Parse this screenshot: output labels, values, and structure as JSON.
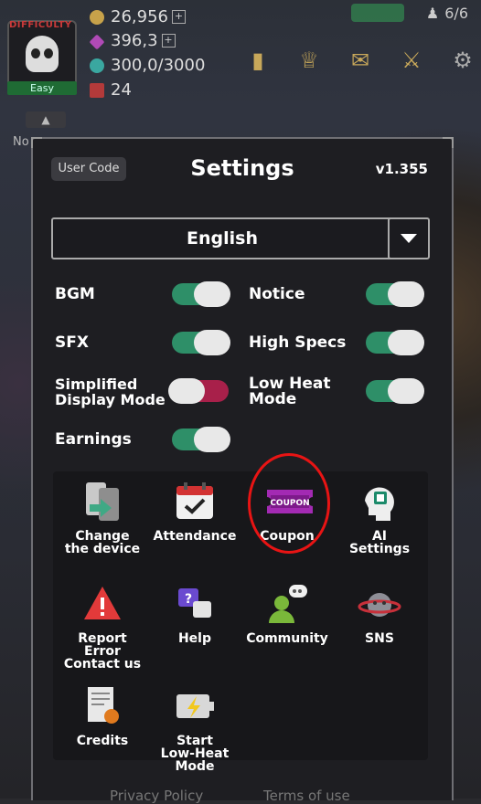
{
  "hud": {
    "difficulty_label": "DIFFICULTY",
    "difficulty": "Easy",
    "gold": "26,956",
    "gems": "396,3",
    "mana": "300,0/3000",
    "tickets": "24",
    "capacity": "6/6"
  },
  "settings": {
    "user_code": "User Code",
    "title": "Settings",
    "version": "v1.355",
    "language": "English",
    "options": {
      "bgm": {
        "label": "BGM",
        "on": true
      },
      "notice": {
        "label": "Notice",
        "on": true
      },
      "sfx": {
        "label": "SFX",
        "on": true
      },
      "high_specs": {
        "label": "High Specs",
        "on": true
      },
      "simplified": {
        "label": "Simplified\nDisplay Mode",
        "on": false
      },
      "low_heat": {
        "label": "Low Heat\nMode",
        "on": true
      },
      "earnings": {
        "label": "Earnings",
        "on": true
      }
    },
    "grid": {
      "change_device": "Change\nthe device",
      "attendance": "Attendance",
      "coupon": "Coupon",
      "ai_settings": "AI\nSettings",
      "report": "Report\nError\nContact us",
      "help": "Help",
      "community": "Community",
      "sns": "SNS",
      "credits": "Credits",
      "low_heat_start": "Start\nLow-Heat\nMode"
    },
    "coupon_icon_text": "COUPON",
    "privacy": "Privacy Policy",
    "terms": "Terms of use"
  },
  "colors": {
    "toggle_on": "#2e8f68",
    "toggle_off": "#a8204a",
    "highlight": "#e81414"
  }
}
